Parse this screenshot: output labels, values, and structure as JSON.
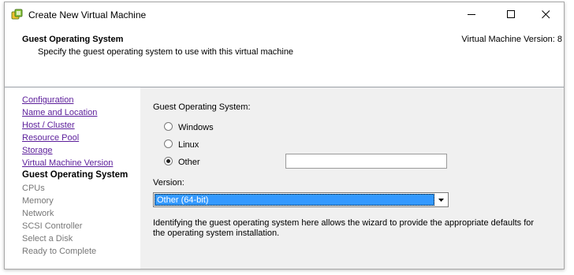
{
  "window": {
    "title": "Create New Virtual Machine",
    "controls": {
      "minimize_icon": "minimize-icon",
      "maximize_icon": "maximize-icon",
      "close_icon": "close-icon"
    }
  },
  "header": {
    "title": "Guest Operating System",
    "subtitle": "Specify the guest operating system to use with this virtual machine",
    "version": "Virtual Machine Version: 8"
  },
  "nav": {
    "items": [
      {
        "label": "Configuration",
        "state": "link"
      },
      {
        "label": "Name and Location",
        "state": "link"
      },
      {
        "label": "Host / Cluster",
        "state": "link"
      },
      {
        "label": "Resource Pool",
        "state": "link"
      },
      {
        "label": "Storage",
        "state": "link"
      },
      {
        "label": "Virtual Machine Version",
        "state": "link"
      },
      {
        "label": "Guest Operating System",
        "state": "current"
      },
      {
        "label": "CPUs",
        "state": "disabled"
      },
      {
        "label": "Memory",
        "state": "disabled"
      },
      {
        "label": "Network",
        "state": "disabled"
      },
      {
        "label": "SCSI Controller",
        "state": "disabled"
      },
      {
        "label": "Select a Disk",
        "state": "disabled"
      },
      {
        "label": "Ready to Complete",
        "state": "disabled"
      }
    ]
  },
  "main": {
    "guest_os_label": "Guest Operating System:",
    "options": [
      {
        "label": "Windows",
        "checked": false
      },
      {
        "label": "Linux",
        "checked": false
      },
      {
        "label": "Other",
        "checked": true
      }
    ],
    "other_value": "",
    "version_label": "Version:",
    "version_selected": "Other (64-bit)",
    "info_text": "Identifying the guest operating system here allows the wizard to provide the appropriate defaults for the operating system installation."
  }
}
